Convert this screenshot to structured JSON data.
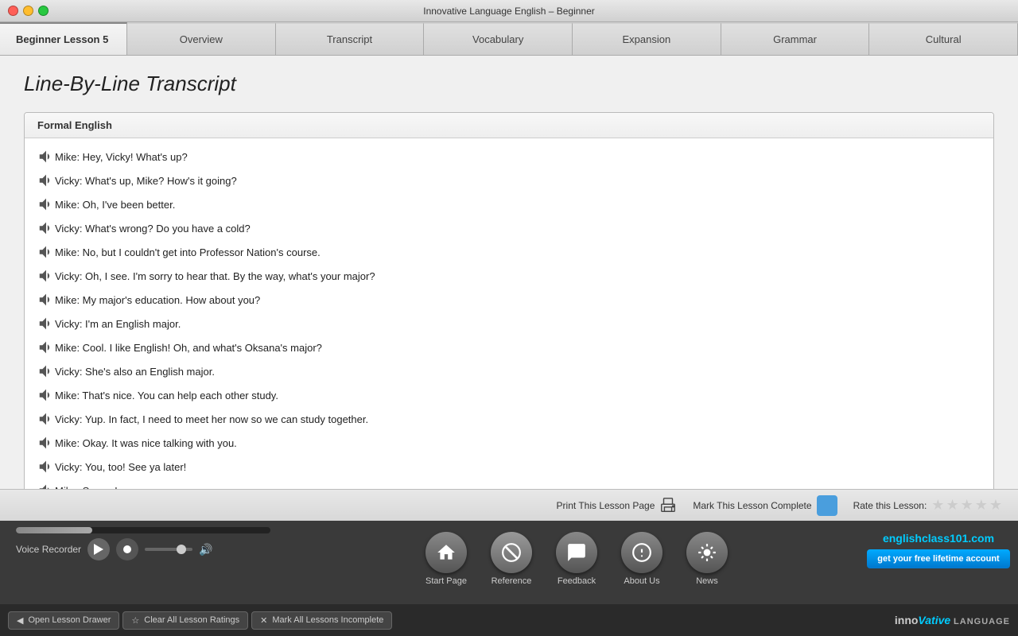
{
  "window": {
    "title": "Innovative Language English – Beginner"
  },
  "tabs": {
    "active": "Beginner Lesson 5",
    "items": [
      {
        "label": "Overview"
      },
      {
        "label": "Transcript"
      },
      {
        "label": "Vocabulary"
      },
      {
        "label": "Expansion"
      },
      {
        "label": "Grammar"
      },
      {
        "label": "Cultural"
      }
    ]
  },
  "content": {
    "title": "Line-By-Line Transcript",
    "section_header": "Formal English",
    "lines": [
      "Mike: Hey, Vicky! What's up?",
      "Vicky: What's up, Mike? How's it going?",
      "Mike: Oh, I've been better.",
      "Vicky: What's wrong? Do you have a cold?",
      "Mike: No, but I couldn't get into Professor Nation's course.",
      "Vicky: Oh, I see. I'm sorry to hear that. By the way, what's your major?",
      "Mike: My major's education. How about you?",
      "Vicky: I'm an English major.",
      "Mike: Cool. I like English! Oh, and what's Oksana's major?",
      "Vicky: She's also an English major.",
      "Mike: That's nice. You can help each other study.",
      "Vicky: Yup. In fact, I need to meet her now so we can study together.",
      "Mike: Okay. It was nice talking with you.",
      "Vicky: You, too! See ya later!",
      "Mike: See ya!"
    ]
  },
  "toolbar": {
    "print_label": "Print This Lesson Page",
    "complete_label": "Mark This Lesson Complete",
    "rate_label": "Rate this Lesson:"
  },
  "player": {
    "progress_percent": 30,
    "recorder_label": "Voice Recorder",
    "volume_level": 65
  },
  "nav_icons": [
    {
      "label": "Start Page",
      "icon": "🏠"
    },
    {
      "label": "Reference",
      "icon": "🚫"
    },
    {
      "label": "Feedback",
      "icon": "💬"
    },
    {
      "label": "About Us",
      "icon": "ℹ️"
    },
    {
      "label": "News",
      "icon": "📡"
    }
  ],
  "promo": {
    "site": "englishclass101.com",
    "cta": "get your free lifetime account"
  },
  "bottom_bar": {
    "buttons": [
      {
        "label": "Open Lesson Drawer",
        "icon": "◀"
      },
      {
        "label": "Clear All Lesson Ratings",
        "icon": "☆"
      },
      {
        "label": "Mark All Lessons Incomplete",
        "icon": "✕"
      }
    ],
    "logo_inno": "inno",
    "logo_vative": "Vative",
    "logo_language": "LANGUAGE"
  }
}
